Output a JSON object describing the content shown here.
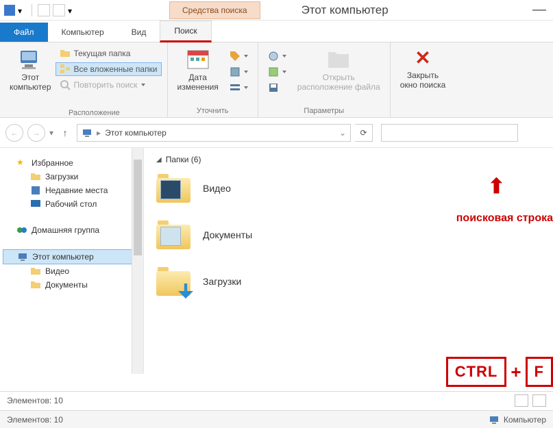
{
  "title_ctx_tab": "Средства поиска",
  "window_title": "Этот компьютер",
  "tabs": {
    "file": "Файл",
    "computer": "Компьютер",
    "view": "Вид",
    "search": "Поиск"
  },
  "ribbon": {
    "this_computer": "Этот\nкомпьютер",
    "current_folder": "Текущая папка",
    "all_subfolders": "Все вложенные папки",
    "repeat_search": "Повторить поиск",
    "location_label": "Расположение",
    "date_modified": "Дата\nизменения",
    "refine_label": "Уточнить",
    "open_location": "Открыть\nрасположение файла",
    "params_label": "Параметры",
    "close_search": "Закрыть\nокно поиска"
  },
  "breadcrumb": {
    "root": "Этот компьютер"
  },
  "tree": {
    "favorites": "Избранное",
    "downloads": "Загрузки",
    "recent": "Недавние места",
    "desktop": "Рабочий стол",
    "homegroup": "Домашняя группа",
    "this_pc": "Этот компьютер",
    "videos": "Видео",
    "documents": "Документы"
  },
  "content": {
    "section": "Папки (6)",
    "items": [
      "Видео",
      "Документы",
      "Загрузки"
    ]
  },
  "status": {
    "elements": "Элементов: 10",
    "computer": "Компьютер"
  },
  "annot": {
    "label": "поисковая строка",
    "kbd1": "CTRL",
    "kbd2": "F"
  }
}
